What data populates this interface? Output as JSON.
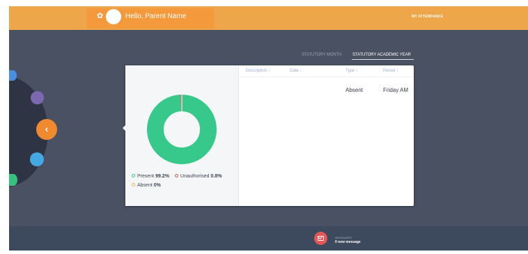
{
  "header": {
    "greeting": "Hello, Parent Name",
    "page_title": "MY ATTENDANCE",
    "settings_icon": "gear-icon",
    "avatar_icon": "avatar"
  },
  "tabs": [
    {
      "label": "STATUTORY MONTH",
      "active": false
    },
    {
      "label": "STATUTORY ACADEMIC YEAR",
      "active": true
    }
  ],
  "navigation": {
    "back_icon": "chevron-left-icon",
    "back_glyph": "‹"
  },
  "summary": {
    "legend": [
      {
        "label": "Present",
        "value": "99.2%",
        "color": "#37c98b"
      },
      {
        "label": "Unauthorised",
        "value": "0.8%",
        "color": "#e5534b"
      },
      {
        "label": "Absent",
        "value": "0%",
        "color": "#f2b84b"
      }
    ],
    "donut": [
      {
        "label": "Present",
        "percent": 99.2,
        "color": "#37c98b"
      },
      {
        "label": "Unauthorised",
        "percent": 0.8,
        "color": "#e5534b"
      },
      {
        "label": "Absent",
        "percent": 0,
        "color": "#f2b84b"
      }
    ]
  },
  "table": {
    "columns": [
      "Description ↕",
      "Date ↓",
      "Type ↕",
      "Period ↕"
    ],
    "rows": [
      {
        "description": "",
        "date": "",
        "type": "Absent",
        "period": "Friday AM"
      }
    ]
  },
  "footer": {
    "messages_heading": "MESSAGES",
    "messages_count": "0 new message",
    "messages_icon": "envelope-icon"
  },
  "colors": {
    "header": "#eda64a",
    "accent": "#f08a2f",
    "background": "#4a5163",
    "present": "#37c98b"
  }
}
